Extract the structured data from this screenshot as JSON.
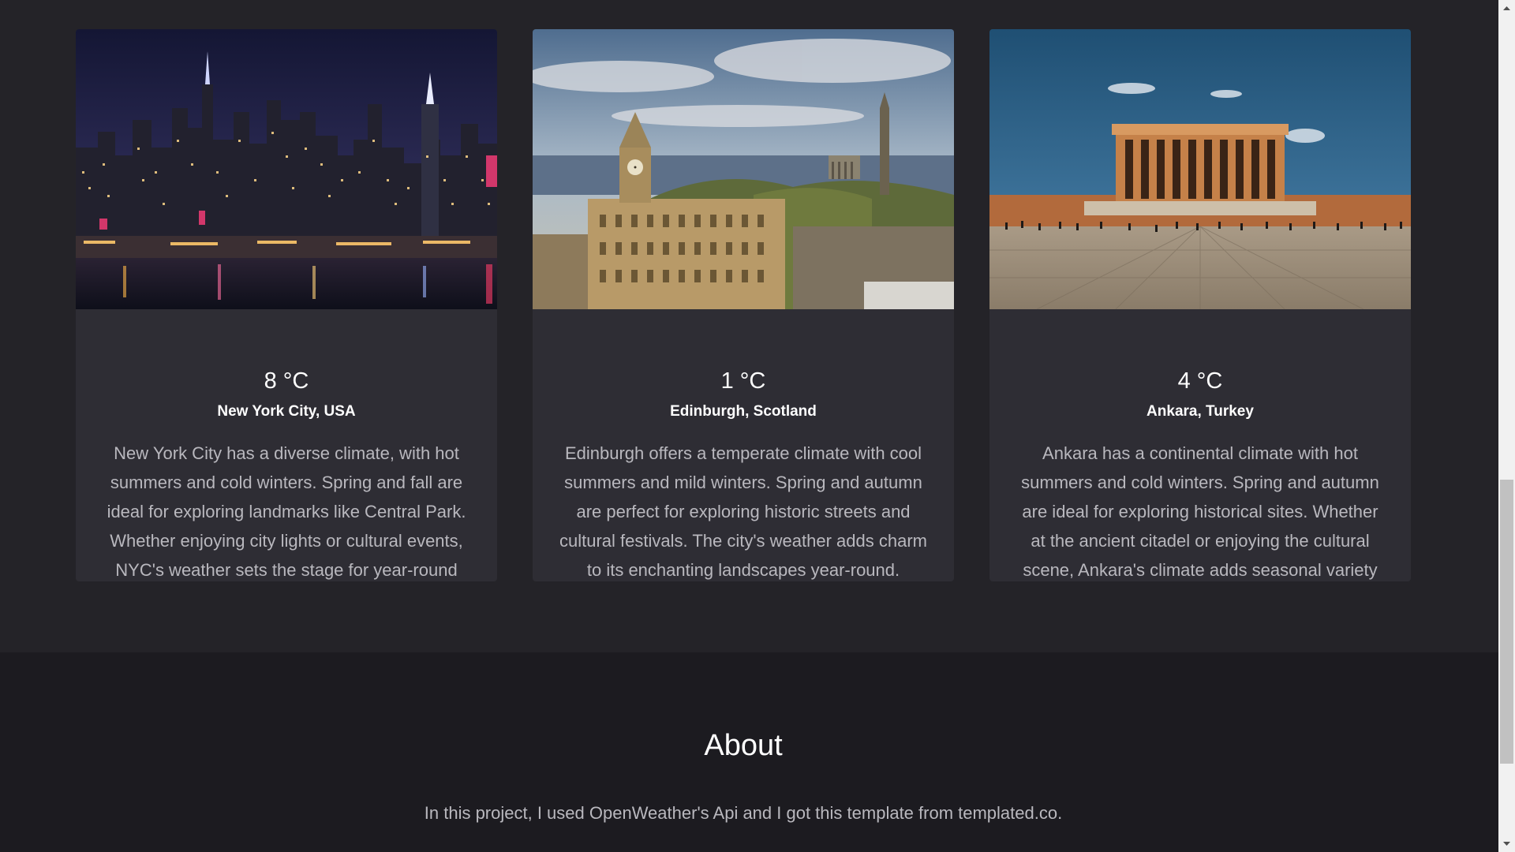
{
  "cards": [
    {
      "image_alt": "New York City skyline at night",
      "temperature": "8 °C",
      "city": "New York City, USA",
      "description": "New York City has a diverse climate, with hot summers and cold winters. Spring and fall are ideal for exploring landmarks like Central Park. Whether enjoying city lights or cultural events, NYC's weather sets the stage for year-round adventures."
    },
    {
      "image_alt": "Edinburgh skyline with Balmoral clock tower and Calton Hill",
      "temperature": "1 °C",
      "city": "Edinburgh, Scotland",
      "description": "Edinburgh offers a temperate climate with cool summers and mild winters. Spring and autumn are perfect for exploring historic streets and cultural festivals. The city's weather adds charm to its enchanting landscapes year-round."
    },
    {
      "image_alt": "Anıtkabir mausoleum in Ankara",
      "temperature": "4 °C",
      "city": "Ankara, Turkey",
      "description": "Ankara has a continental climate with hot summers and cold winters. Spring and autumn are ideal for exploring historical sites. Whether at the ancient citadel or enjoying the cultural scene, Ankara's climate adds seasonal variety for visitors."
    }
  ],
  "about": {
    "title": "About",
    "text": "In this project, I used OpenWeather's Api and I got this template from templated.co."
  },
  "colors": {
    "background": "#242328",
    "card_background": "#2e2d34",
    "about_background": "#1c1b20",
    "heading_text": "#ffffff",
    "body_text": "#b9b8be"
  },
  "icons": {
    "scroll_up": "triangle-up-icon",
    "scroll_down": "triangle-down-icon"
  }
}
